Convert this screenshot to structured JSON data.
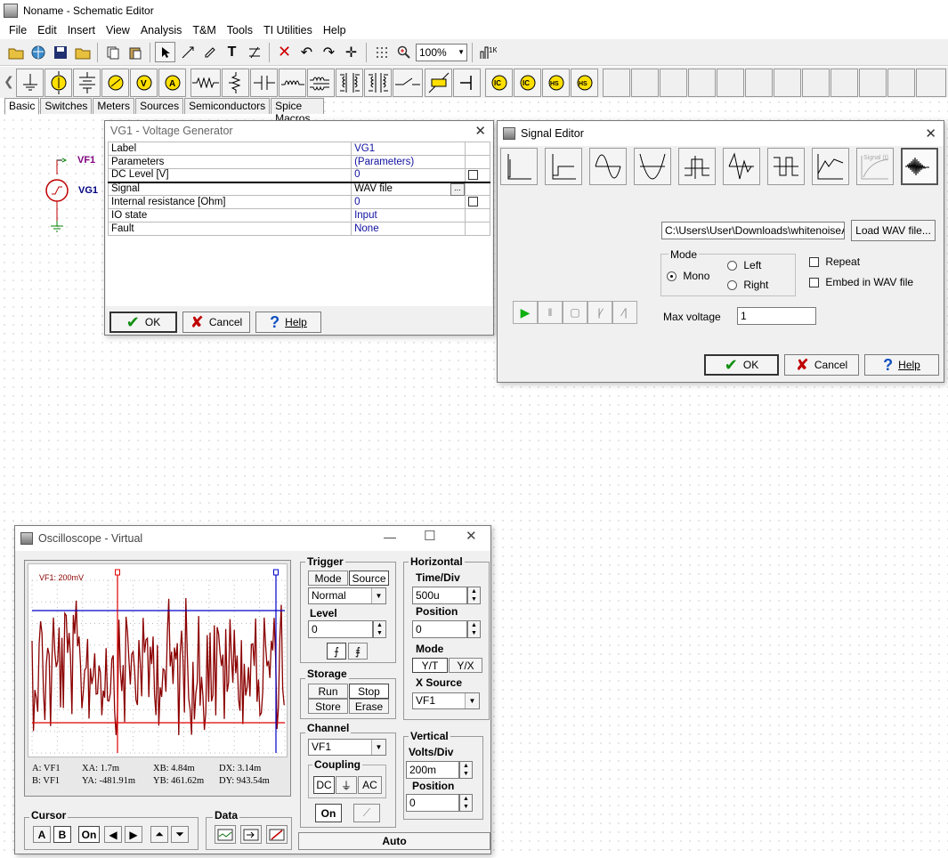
{
  "window": {
    "title": "Noname - Schematic Editor"
  },
  "menu": [
    "File",
    "Edit",
    "Insert",
    "View",
    "Analysis",
    "T&M",
    "Tools",
    "TI Utilities",
    "Help"
  ],
  "toolbar": {
    "zoom": "100%"
  },
  "component_tabs": [
    "Basic",
    "Switches",
    "Meters",
    "Sources",
    "Semiconductors",
    "Spice Macros"
  ],
  "schematic": {
    "vf1_label": "VF1",
    "vg1_label": "VG1"
  },
  "voltage_dialog": {
    "title": "VG1 - Voltage Generator",
    "rows": [
      {
        "label": "Label",
        "value": "VG1"
      },
      {
        "label": "Parameters",
        "value": "(Parameters)"
      },
      {
        "label": "DC Level [V]",
        "value": "0"
      },
      {
        "label": "Signal",
        "value": "WAV file",
        "button": "..."
      },
      {
        "label": "Internal resistance [Ohm]",
        "value": "0"
      },
      {
        "label": "IO state",
        "value": "Input"
      },
      {
        "label": "Fault",
        "value": "None"
      }
    ],
    "ok": "OK",
    "cancel": "Cancel",
    "help": "Help"
  },
  "signal_editor": {
    "title": "Signal Editor",
    "signal_button_label": "Signal (t)",
    "wav_path": "C:\\Users\\User\\Downloads\\whitenoiseAdif",
    "load_wav": "Load WAV file...",
    "mode_label": "Mode",
    "mono": "Mono",
    "left": "Left",
    "right": "Right",
    "repeat": "Repeat",
    "embed": "Embed in WAV file",
    "max_voltage_label": "Max voltage",
    "max_voltage": "1",
    "ok": "OK",
    "cancel": "Cancel",
    "help": "Help"
  },
  "oscilloscope": {
    "title": "Oscilloscope - Virtual",
    "screen_label": "VF1: 200mV",
    "readouts": {
      "a": "A:  VF1",
      "b": "B:  VF1",
      "xa": "XA:  1.7m",
      "ya": "YA:  -481.91m",
      "xb": "XB:  4.84m",
      "yb": "YB:  461.62m",
      "dx": "DX:  3.14m",
      "dy": "DY:  943.54m"
    },
    "cursor": {
      "label": "Cursor",
      "a": "A",
      "b": "B",
      "on": "On"
    },
    "data": {
      "label": "Data"
    },
    "trigger": {
      "label": "Trigger",
      "mode": "Mode",
      "source": "Source",
      "mode_value": "Normal",
      "level_label": "Level",
      "level": "0"
    },
    "storage": {
      "label": "Storage",
      "run": "Run",
      "stop": "Stop",
      "store": "Store",
      "erase": "Erase"
    },
    "channel": {
      "label": "Channel",
      "value": "VF1",
      "coupling_label": "Coupling",
      "dc": "DC",
      "ac": "AC",
      "on": "On"
    },
    "horizontal": {
      "label": "Horizontal",
      "time_div_label": "Time/Div",
      "time_div": "500u",
      "position_label": "Position",
      "position": "0",
      "mode_label": "Mode",
      "yt": "Y/T",
      "yx": "Y/X",
      "xsource_label": "X Source",
      "xsource": "VF1"
    },
    "vertical": {
      "label": "Vertical",
      "volts_div_label": "Volts/Div",
      "volts_div": "200m",
      "position_label": "Position",
      "position": "0"
    },
    "auto": "Auto"
  },
  "colors": {
    "trace": "#8b0000",
    "cursor_a": "#e00000",
    "cursor_b": "#0000c8",
    "screen_bg": "#ffffff"
  }
}
